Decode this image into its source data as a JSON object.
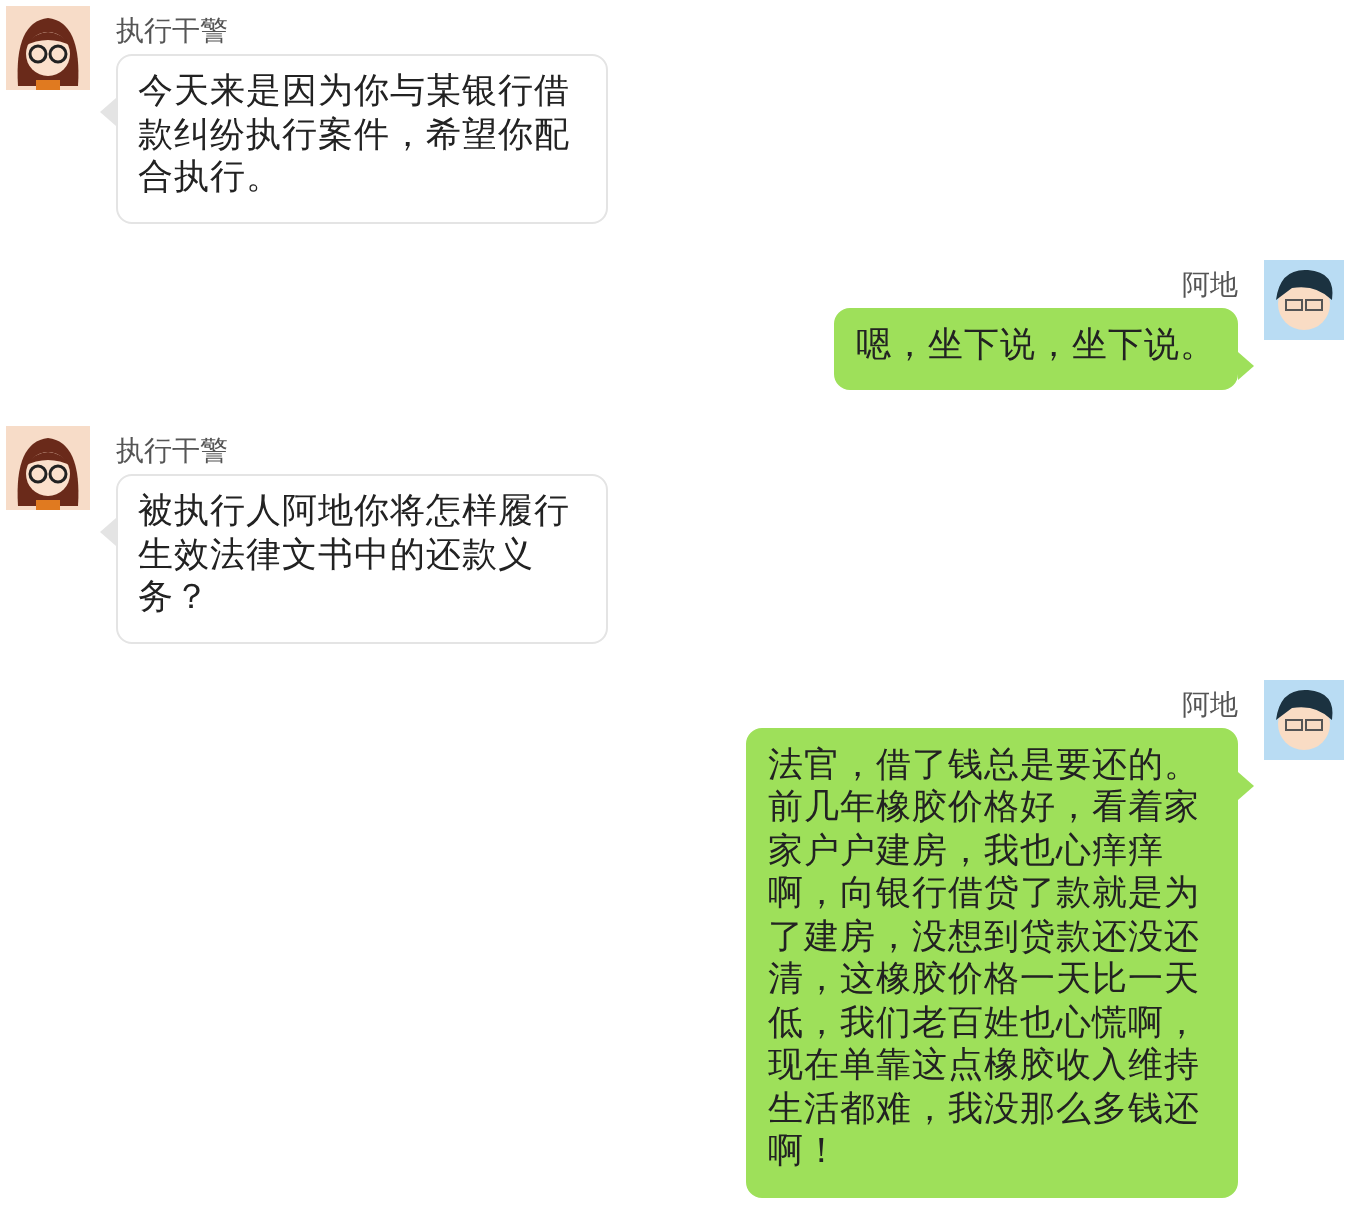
{
  "messages": [
    {
      "kind": "incoming",
      "sender": "执行干警",
      "text": "今天来是因为你与某银行借款纠纷执行案件，希望你配合执行。"
    },
    {
      "kind": "outgoing",
      "sender": "阿地",
      "text": "嗯，坐下说，坐下说。"
    },
    {
      "kind": "incoming",
      "sender": "执行干警",
      "text": "被执行人阿地你将怎样履行生效法律文书中的还款义务？"
    },
    {
      "kind": "outgoing",
      "sender": "阿地",
      "text": "法官，借了钱总是要还的。前几年橡胶价格好，看着家家户户建房，我也心痒痒啊，向银行借贷了款就是为了建房，没想到贷款还没还清，这橡胶价格一天比一天低，我们老百姓也心慌啊，现在单靠这点橡胶收入维持生活都难，我没那么多钱还啊！"
    }
  ]
}
